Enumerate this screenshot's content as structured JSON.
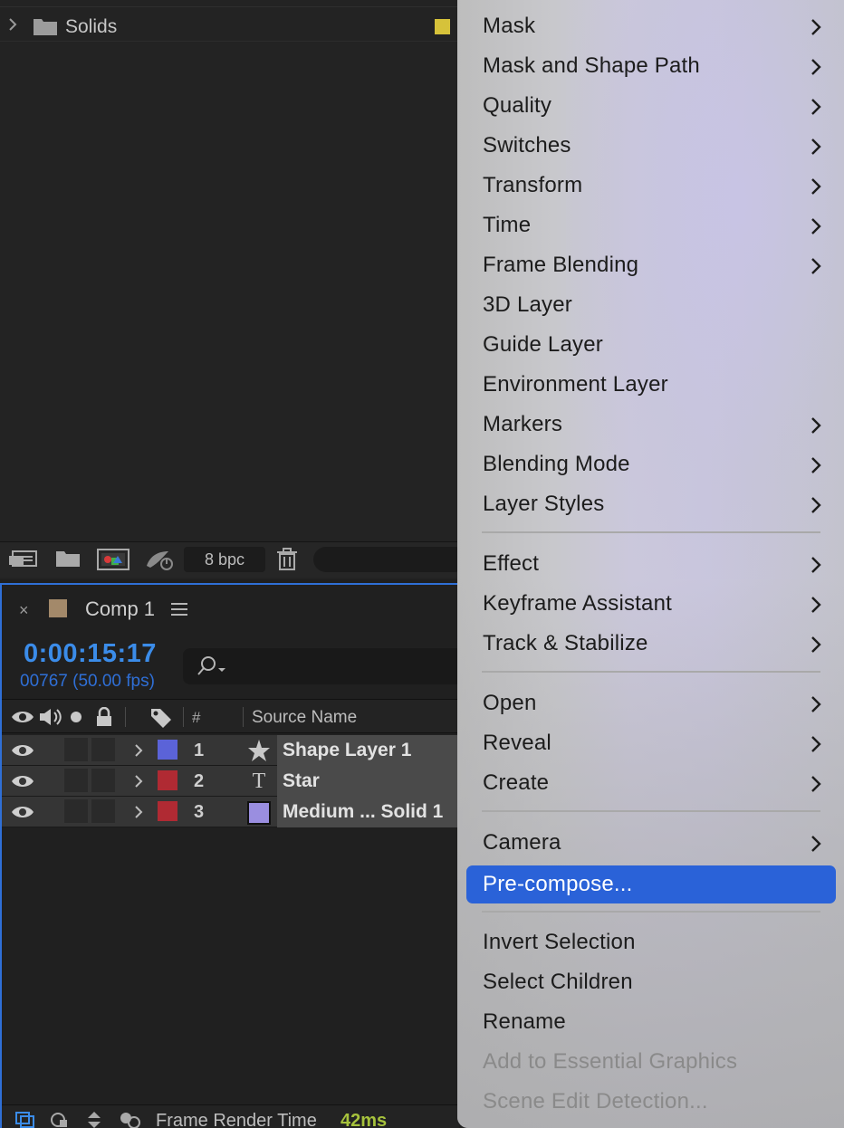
{
  "project_panel": {
    "folder_row": {
      "name": "Solids",
      "label_color": "#d6c23a"
    },
    "toolbar": {
      "bit_depth": "8 bpc"
    }
  },
  "timeline": {
    "tab": {
      "title": "Comp 1",
      "label_color": "#a3896a"
    },
    "timecode": "0:00:15:17",
    "frame_info": "00767 (50.00 fps)",
    "columns": {
      "number": "#",
      "source_name": "Source Name"
    },
    "layers": [
      {
        "number": "1",
        "type_icon": "star-icon",
        "label_color": "#5b63d8",
        "name": "Shape Layer 1"
      },
      {
        "number": "2",
        "type_icon": "text-layer-icon",
        "type_glyph": "T",
        "label_color": "#b02a33",
        "name": "Star"
      },
      {
        "number": "3",
        "type_icon": "solid-swatch",
        "label_color": "#b02a33",
        "solid_color": "#9a8ee0",
        "name": "Medium ... Solid 1"
      }
    ],
    "footer": {
      "render_time_label": "Frame Render Time",
      "render_time_value": "42ms"
    }
  },
  "context_menu": {
    "items": [
      {
        "label": "Mask",
        "submenu": true
      },
      {
        "label": "Mask and Shape Path",
        "submenu": true
      },
      {
        "label": "Quality",
        "submenu": true
      },
      {
        "label": "Switches",
        "submenu": true
      },
      {
        "label": "Transform",
        "submenu": true
      },
      {
        "label": "Time",
        "submenu": true
      },
      {
        "label": "Frame Blending",
        "submenu": true
      },
      {
        "label": "3D Layer",
        "submenu": false
      },
      {
        "label": "Guide Layer",
        "submenu": false
      },
      {
        "label": "Environment Layer",
        "submenu": false
      },
      {
        "label": "Markers",
        "submenu": true
      },
      {
        "label": "Blending Mode",
        "submenu": true
      },
      {
        "label": "Layer Styles",
        "submenu": true
      },
      {
        "label": "Effect",
        "submenu": true
      },
      {
        "label": "Keyframe Assistant",
        "submenu": true
      },
      {
        "label": "Track & Stabilize",
        "submenu": true
      },
      {
        "label": "Open",
        "submenu": true
      },
      {
        "label": "Reveal",
        "submenu": true
      },
      {
        "label": "Create",
        "submenu": true
      },
      {
        "label": "Camera",
        "submenu": true
      },
      {
        "label": "Pre-compose...",
        "submenu": false,
        "highlighted": true
      },
      {
        "label": "Invert Selection",
        "submenu": false
      },
      {
        "label": "Select Children",
        "submenu": false
      },
      {
        "label": "Rename",
        "submenu": false
      },
      {
        "label": "Add to Essential Graphics",
        "submenu": false,
        "disabled": true
      },
      {
        "label": "Scene Edit Detection...",
        "submenu": false,
        "disabled": true
      }
    ],
    "highlight_color": "#2a62d8"
  }
}
